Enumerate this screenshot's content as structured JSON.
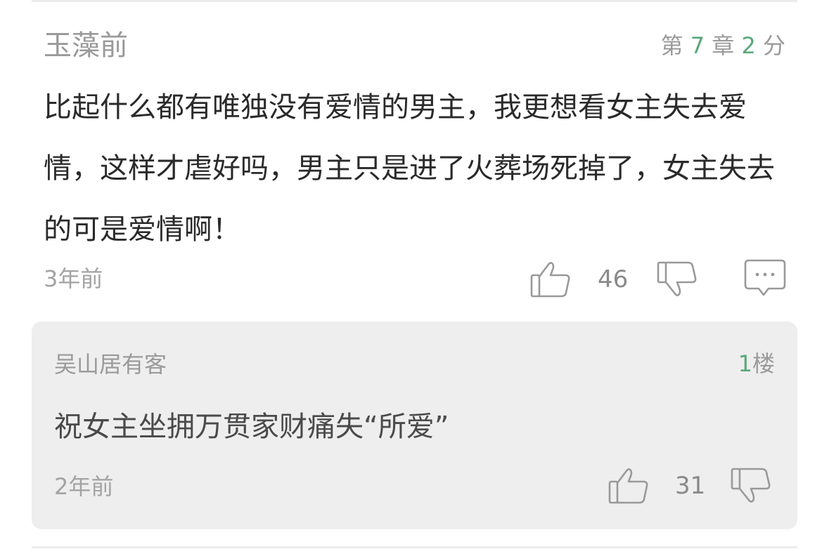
{
  "comment": {
    "author": "玉藻前",
    "chapter_prefix": "第",
    "chapter_number": "7",
    "chapter_suffix": "章",
    "score": "2",
    "score_unit": "分",
    "text": "比起什么都有唯独没有爱情的男主，我更想看女主失去爱情，这样才虐好吗，男主只是进了火葬场死掉了，女主失去的可是爱情啊！",
    "time": "3年前",
    "like_count": "46",
    "icons": {
      "like": "thumbs-up-icon",
      "dislike": "thumbs-down-icon",
      "reply": "comment-bubble-icon"
    }
  },
  "reply": {
    "author": "吴山居有客",
    "floor_number": "1",
    "floor_label": "楼",
    "text": "祝女主坐拥万贯家财痛失“所爱”",
    "time": "2年前",
    "like_count": "31",
    "icons": {
      "like": "thumbs-up-icon",
      "dislike": "thumbs-down-icon"
    }
  },
  "colors": {
    "accent_green": "#5aa87a",
    "muted_text": "#9a9a9a",
    "body_text": "#2a2a2a",
    "reply_background": "#eeeeee"
  }
}
